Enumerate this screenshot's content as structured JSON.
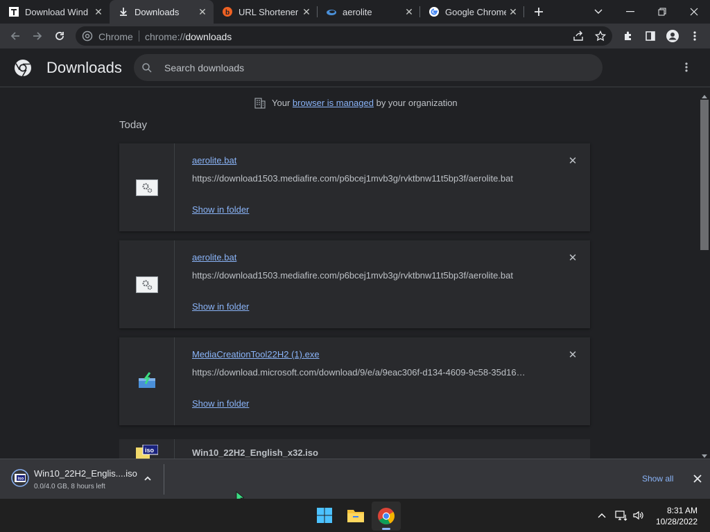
{
  "tabs": [
    {
      "title": "Download Wind",
      "active": false
    },
    {
      "title": "Downloads",
      "active": true
    },
    {
      "title": "URL Shortener -",
      "active": false
    },
    {
      "title": "aerolite",
      "active": false
    },
    {
      "title": "Google Chrome",
      "active": false
    }
  ],
  "toolbar": {
    "site_label": "Chrome",
    "url_scheme": "chrome://",
    "url_path": "downloads"
  },
  "page": {
    "title": "Downloads",
    "search_placeholder": "Search downloads",
    "managed_prefix": "Your",
    "managed_link": "browser is managed",
    "managed_suffix": "by your organization",
    "section_today": "Today"
  },
  "downloads": [
    {
      "filename": "aerolite.bat",
      "url": "https://download1503.mediafire.com/p6bcej1mvb3g/rvktbnw11t5bp3f/aerolite.bat",
      "action": "Show in folder",
      "icon": "batch-file-icon"
    },
    {
      "filename": "aerolite.bat",
      "url": "https://download1503.mediafire.com/p6bcej1mvb3g/rvktbnw11t5bp3f/aerolite.bat",
      "action": "Show in folder",
      "icon": "batch-file-icon"
    },
    {
      "filename": "MediaCreationTool22H2 (1).exe",
      "url": "https://download.microsoft.com/download/9/e/a/9eac306f-d134-4609-9c58-35d16…",
      "action": "Show in folder",
      "icon": "installer-icon"
    },
    {
      "filename": "Win10_22H2_English_x32.iso",
      "icon": "iso-file-icon"
    }
  ],
  "shelf": {
    "item_name": "Win10_22H2_Englis....iso",
    "item_status": "0.0/4.0 GB, 8 hours left",
    "show_all": "Show all"
  },
  "taskbar": {
    "time": "8:31 AM",
    "date": "10/28/2022"
  },
  "colors": {
    "accent_link": "#8ab4f8",
    "background": "#202124",
    "card": "#292a2d"
  }
}
